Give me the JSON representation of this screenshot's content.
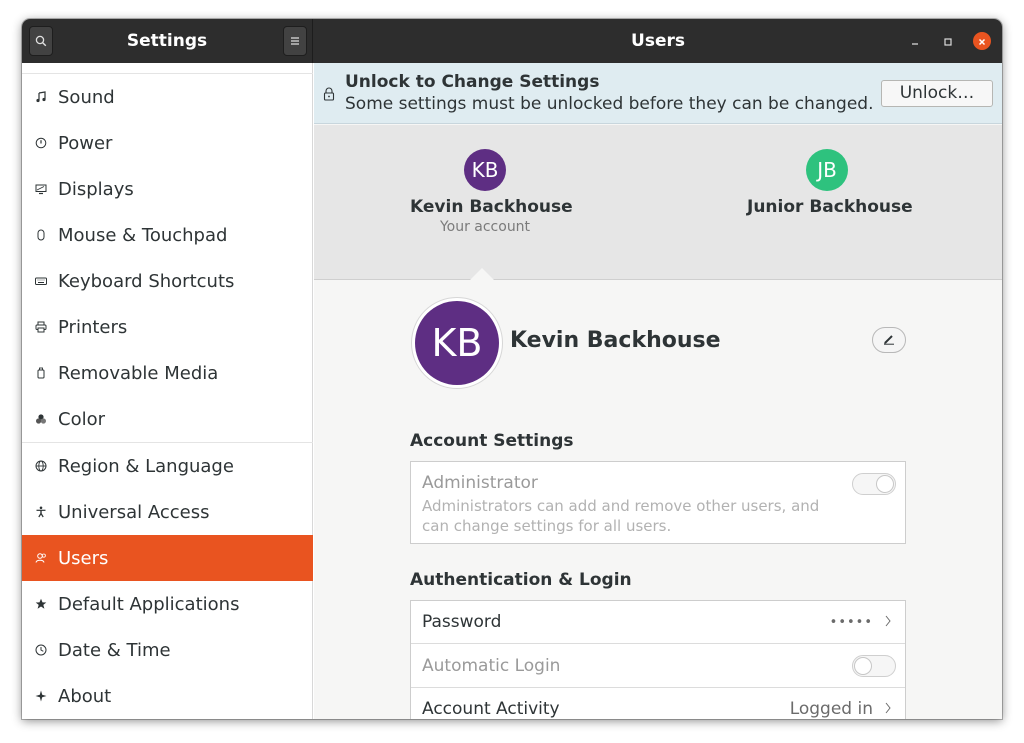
{
  "window": {
    "left_title": "Settings",
    "right_title": "Users",
    "controls": {
      "minimize_icon": "minimize-icon",
      "maximize_icon": "maximize-icon",
      "close_icon": "close-icon",
      "close_color": "#e95420"
    }
  },
  "sidebar": {
    "search_icon": "search-icon",
    "menu_icon": "hamburger-menu-icon",
    "accent_color": "#e95420",
    "items": [
      {
        "label": "Sound",
        "icon": "music-note-icon"
      },
      {
        "label": "Power",
        "icon": "power-icon"
      },
      {
        "label": "Displays",
        "icon": "display-icon"
      },
      {
        "label": "Mouse & Touchpad",
        "icon": "mouse-icon"
      },
      {
        "label": "Keyboard Shortcuts",
        "icon": "keyboard-icon"
      },
      {
        "label": "Printers",
        "icon": "printer-icon"
      },
      {
        "label": "Removable Media",
        "icon": "removable-media-icon"
      },
      {
        "label": "Color",
        "icon": "color-icon"
      },
      {
        "label": "Region & Language",
        "icon": "globe-icon"
      },
      {
        "label": "Universal Access",
        "icon": "accessibility-icon"
      },
      {
        "label": "Users",
        "icon": "users-icon",
        "active": true
      },
      {
        "label": "Default Applications",
        "icon": "star-icon"
      },
      {
        "label": "Date & Time",
        "icon": "clock-icon"
      },
      {
        "label": "About",
        "icon": "about-icon"
      }
    ]
  },
  "infobar": {
    "icon": "lock-icon",
    "title": "Unlock to Change Settings",
    "subtitle": "Some settings must be unlocked before they can be changed.",
    "button": "Unlock…"
  },
  "carousel": {
    "users": [
      {
        "initials": "KB",
        "name": "Kevin Backhouse",
        "sub": "Your account",
        "color": "#5e2e83"
      },
      {
        "initials": "JB",
        "name": "Junior Backhouse",
        "sub": "",
        "color": "#2ec27e"
      }
    ]
  },
  "profile": {
    "initials": "KB",
    "name": "Kevin Backhouse",
    "edit_icon": "pencil-icon"
  },
  "account_settings": {
    "heading": "Account Settings",
    "administrator": {
      "label": "Administrator",
      "description": "Administrators can add and remove other users, and can change settings for all users.",
      "enabled": false
    }
  },
  "auth": {
    "heading": "Authentication & Login",
    "password": {
      "label": "Password",
      "value": "•••••"
    },
    "automatic_login": {
      "label": "Automatic Login",
      "enabled": false
    },
    "account_activity": {
      "label": "Account Activity",
      "value": "Logged in"
    }
  }
}
